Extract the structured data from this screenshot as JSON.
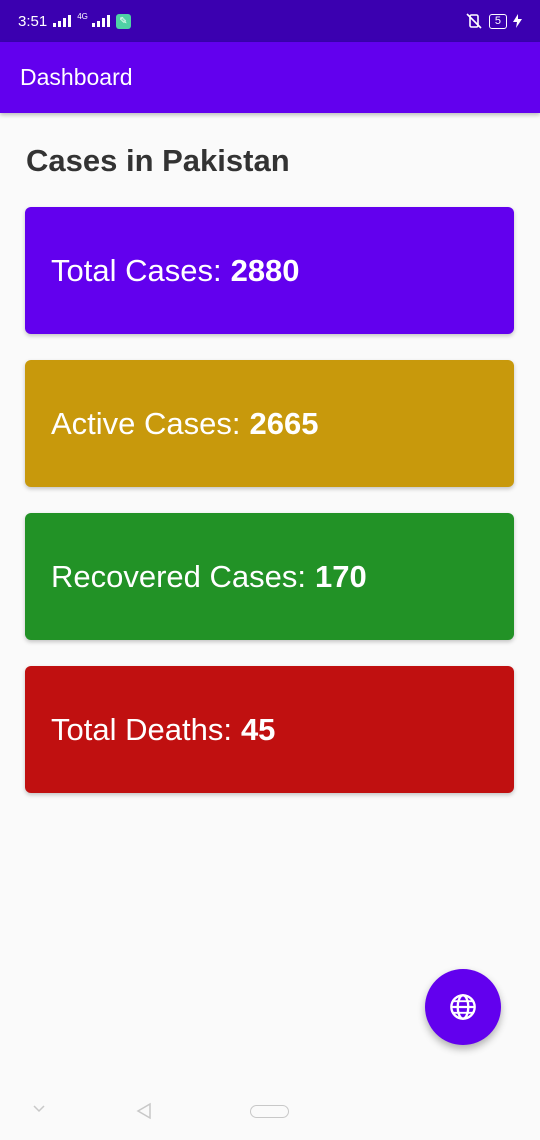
{
  "status_bar": {
    "time": "3:51",
    "network_tag": "4G",
    "battery": "5"
  },
  "app_bar": {
    "title": "Dashboard"
  },
  "main": {
    "heading": "Cases in Pakistan",
    "cards": [
      {
        "label": "Total Cases:",
        "value": "2880",
        "color": "#6200ee"
      },
      {
        "label": "Active Cases:",
        "value": "2665",
        "color": "#c8990c"
      },
      {
        "label": "Recovered Cases:",
        "value": "170",
        "color": "#229226"
      },
      {
        "label": "Total Deaths:",
        "value": "45",
        "color": "#c01010"
      }
    ]
  },
  "fab": {
    "icon": "globe-icon",
    "color": "#6200ee"
  },
  "nav_bar": {
    "icons": [
      "chevron-down-icon",
      "back-icon",
      "home-icon"
    ]
  }
}
